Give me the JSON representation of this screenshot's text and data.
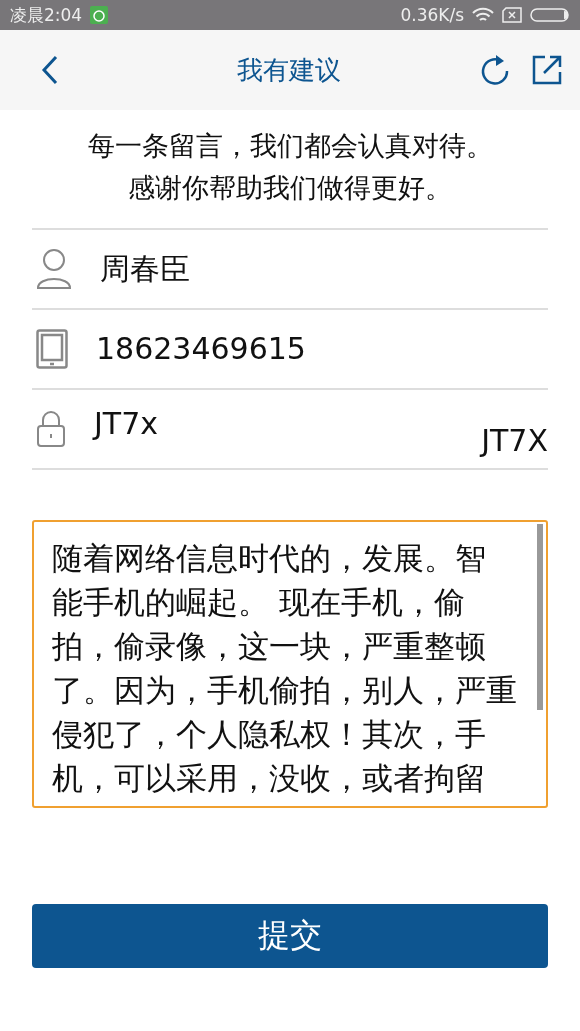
{
  "status_bar": {
    "time": "凌晨2:04",
    "speed": "0.36K/s"
  },
  "header": {
    "title": "我有建议"
  },
  "intro": [
    "每一条留言，我们都会认真对待。",
    "感谢你帮助我们做得更好。"
  ],
  "fields": [
    {
      "kind": "name",
      "value": "周春臣"
    },
    {
      "kind": "phone",
      "value": "18623469615"
    },
    {
      "kind": "code",
      "value": "JT7x",
      "captcha": "JT7X"
    }
  ],
  "message": {
    "lines": [
      "随着网络信息时代的，发展。智",
      "能手机的崛起。 现在手机，偷",
      "拍，偷录像，这一块，严重整顿",
      "了。因为，手机偷拍，别人，严重",
      "侵犯了，个人隐私权！其次，手",
      "机，可以采用，没收，或者拘留"
    ]
  },
  "submit": {
    "label": "提交"
  }
}
